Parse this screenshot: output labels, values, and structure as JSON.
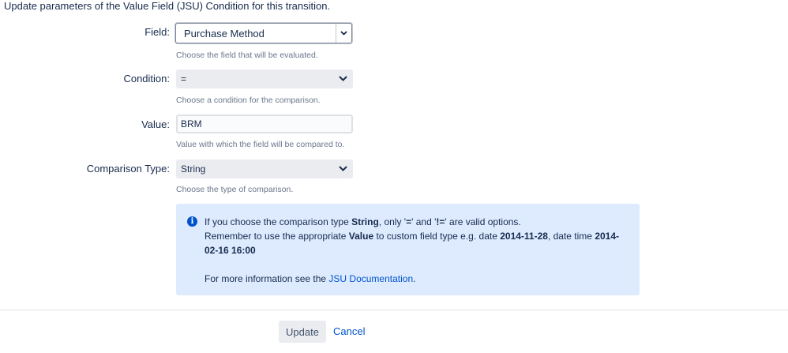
{
  "intro": "Update parameters of the Value Field (JSU) Condition for this transition.",
  "field": {
    "label": "Field:",
    "value": "Purchase Method",
    "description": "Choose the field that will be evaluated."
  },
  "condition": {
    "label": "Condition:",
    "value": "=",
    "description": "Choose a condition for the comparison."
  },
  "value_field": {
    "label": "Value:",
    "value": "BRM",
    "description": "Value with which the field will be compared to."
  },
  "comparison_type": {
    "label": "Comparison Type:",
    "value": "String",
    "description": "Choose the type of comparison."
  },
  "info": {
    "line1_a": "If you choose the comparison type ",
    "line1_b": "String",
    "line1_c": ", only '",
    "line1_d": "=",
    "line1_e": "' and '",
    "line1_f": "!=",
    "line1_g": "' are valid options.",
    "line2_a": "Remember to use the appropriate ",
    "line2_b": "Value",
    "line2_c": " to custom field type e.g. date ",
    "line2_d": "2014-11-28",
    "line2_e": ", date time ",
    "line2_f": "2014-02-16 16:00",
    "line3_a": "For more information see the ",
    "line3_link": "JSU Documentation",
    "line3_c": "."
  },
  "buttons": {
    "update": "Update",
    "cancel": "Cancel"
  },
  "colors": {
    "info_bg": "#deebff",
    "link": "#0052cc",
    "icon": "#0052cc"
  }
}
